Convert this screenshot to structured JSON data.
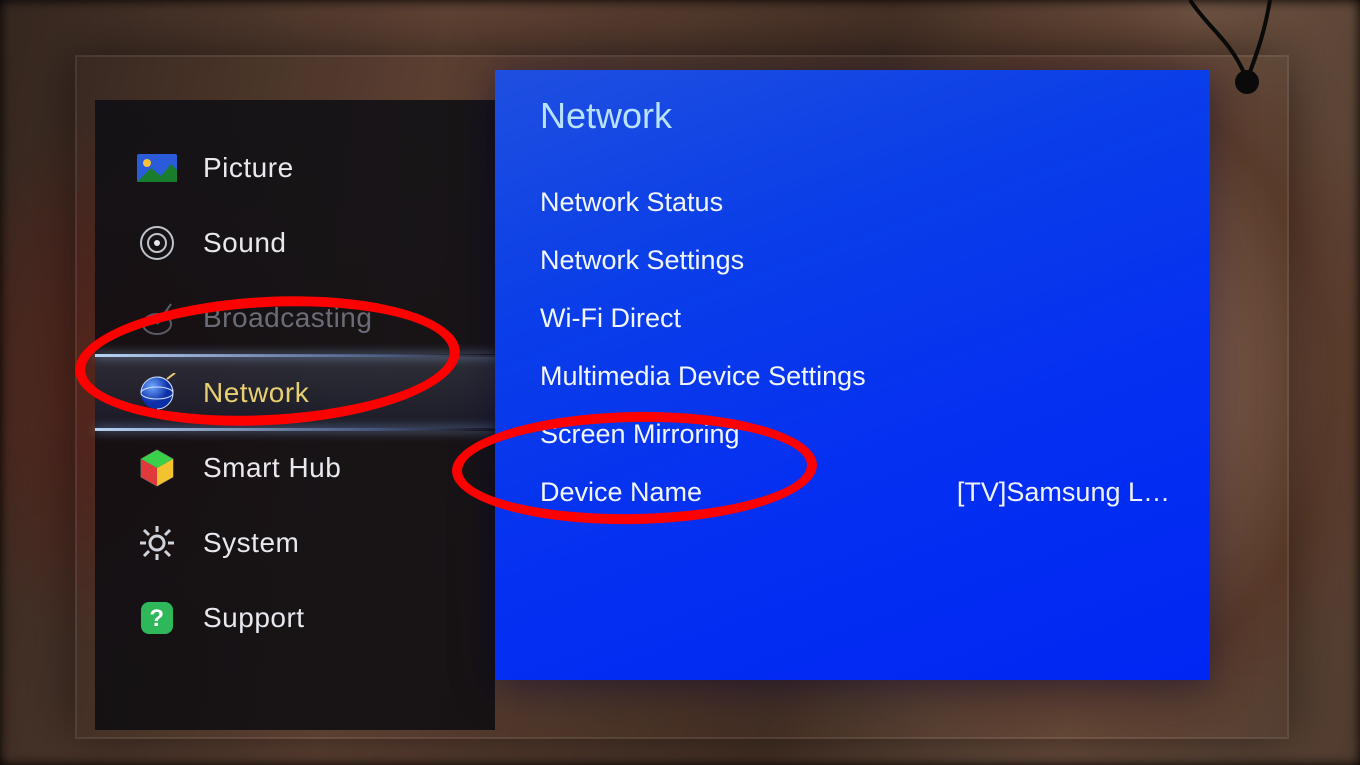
{
  "sidebar": {
    "items": [
      {
        "label": "Picture",
        "icon": "picture-icon",
        "state": "normal"
      },
      {
        "label": "Sound",
        "icon": "sound-icon",
        "state": "normal"
      },
      {
        "label": "Broadcasting",
        "icon": "broadcast-icon",
        "state": "disabled"
      },
      {
        "label": "Network",
        "icon": "network-icon",
        "state": "selected"
      },
      {
        "label": "Smart Hub",
        "icon": "smarthub-icon",
        "state": "normal"
      },
      {
        "label": "System",
        "icon": "system-icon",
        "state": "normal"
      },
      {
        "label": "Support",
        "icon": "support-icon",
        "state": "normal"
      }
    ]
  },
  "panel": {
    "title": "Network",
    "items": [
      {
        "label": "Network Status",
        "value": ""
      },
      {
        "label": "Network Settings",
        "value": ""
      },
      {
        "label": "Wi-Fi Direct",
        "value": ""
      },
      {
        "label": "Multimedia Device Settings",
        "value": ""
      },
      {
        "label": "Screen Mirroring",
        "value": ""
      },
      {
        "label": "Device Name",
        "value": "[TV]Samsung L…"
      }
    ]
  },
  "annotations": {
    "highlight_sidebar": "Network",
    "highlight_panel": "Screen Mirroring"
  }
}
